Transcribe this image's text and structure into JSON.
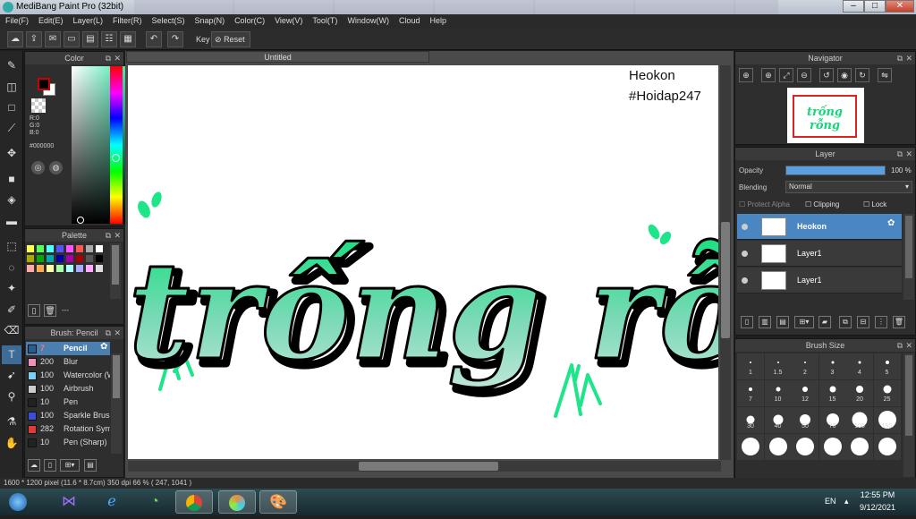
{
  "window": {
    "title": "MediBang Paint Pro (32bit)",
    "controls": {
      "minimize": "–",
      "maximize": "□",
      "close": "✕"
    }
  },
  "menu": [
    "File(F)",
    "Edit(E)",
    "Layer(L)",
    "Filter(R)",
    "Select(S)",
    "Snap(N)",
    "Color(C)",
    "View(V)",
    "Tool(T)",
    "Window(W)",
    "Cloud",
    "Help"
  ],
  "toolbar": {
    "key_label": "Key",
    "reset_label": "Reset"
  },
  "color_panel": {
    "title": "Color",
    "rgb": [
      "R:0",
      "G:0",
      "B:0"
    ],
    "hex": "#000000",
    "foreground": "#000000",
    "background": "#ffffff"
  },
  "palette_panel": {
    "title": "Palette",
    "swatches": [
      "#ffff55",
      "#55ff55",
      "#55ffff",
      "#5555ff",
      "#ff55ff",
      "#ff5555",
      "#aaaaaa",
      "#ffffff",
      "#aaaa00",
      "#00aa00",
      "#00aaaa",
      "#0000aa",
      "#aa00aa",
      "#aa0000",
      "#555555",
      "#000000",
      "#ffaaaa",
      "#ffaa55",
      "#ffffaa",
      "#aaffaa",
      "#aaffff",
      "#aaaaff",
      "#ffaaff",
      "#dddddd"
    ],
    "footer_text": "---"
  },
  "brush_panel": {
    "title": "Brush: Pencil",
    "items": [
      {
        "size": "7",
        "name": "Pencil",
        "color": "#2b5d8a",
        "selected": true
      },
      {
        "size": "200",
        "name": "Blur",
        "color": "#f28fb8"
      },
      {
        "size": "100",
        "name": "Watercolor (W",
        "color": "#7fd0f0"
      },
      {
        "size": "100",
        "name": "Airbrush",
        "color": "#cccccc"
      },
      {
        "size": "10",
        "name": "Pen",
        "color": "#222222"
      },
      {
        "size": "100",
        "name": "Sparkle Brush",
        "color": "#3b4fd6"
      },
      {
        "size": "282",
        "name": "Rotation Sym",
        "color": "#e03b3b"
      },
      {
        "size": "10",
        "name": "Pen (Sharp)",
        "color": "#222222"
      }
    ]
  },
  "document": {
    "tab_title": "Untitled",
    "annotations": [
      "Heokon",
      "#Hoidap247"
    ],
    "artwork_text": "trống rỗng",
    "art_color": "#1de58a"
  },
  "navigator_panel": {
    "title": "Navigator"
  },
  "layer_panel": {
    "title": "Layer",
    "opacity_label": "Opacity",
    "opacity_value": "100 %",
    "opacity_fraction": 1.0,
    "blending_label": "Blending",
    "blending_value": "Normal",
    "protect_alpha": "Protect Alpha",
    "clipping": "Clipping",
    "lock": "Lock",
    "layers": [
      {
        "name": "Heokon",
        "selected": true
      },
      {
        "name": "Layer1",
        "selected": false
      },
      {
        "name": "Layer1",
        "selected": false
      }
    ]
  },
  "brush_size_panel": {
    "title": "Brush Size",
    "sizes": [
      "1",
      "1.5",
      "2",
      "3",
      "4",
      "5",
      "7",
      "10",
      "12",
      "15",
      "20",
      "25",
      "30",
      "40",
      "50",
      "70",
      "100",
      "150",
      "",
      "",
      "",
      "",
      "",
      ""
    ]
  },
  "status": {
    "text": "1600 * 1200 pixel   (11.6 * 8.7cm)   350 dpi   66 %   ( 247, 1041 )"
  },
  "taskbar": {
    "language": "EN",
    "time": "12:55 PM",
    "date": "9/12/2021"
  }
}
